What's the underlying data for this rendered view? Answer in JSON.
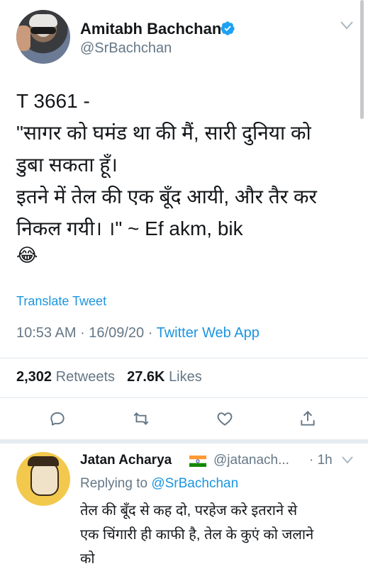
{
  "tweet": {
    "author_name": "Amitabh Bachchan",
    "author_handle": "@SrBachchan",
    "text": "T 3661 -\n\"सागर को घमंड था की मैं, सारी दुनिया को\nडुबा सकता हूँ।\nइतने में तेल की एक बूँद आयी, और तैर कर\nनिकल गयी। ।\" ~ Ef akm, bik",
    "emoji": "😂",
    "translate_label": "Translate Tweet",
    "time": "10:53 AM",
    "date": "16/09/20",
    "source": "Twitter Web App",
    "retweets_count": "2,302",
    "retweets_label": "Retweets",
    "likes_count": "27.6K",
    "likes_label": "Likes"
  },
  "icons": {
    "verified": "verified-badge-icon",
    "chevron": "chevron-down-icon",
    "reply": "reply-icon",
    "retweet": "retweet-icon",
    "like": "heart-icon",
    "share": "share-icon",
    "flag": "india-flag-icon"
  },
  "reply": {
    "author_name": "Jatan Acharya",
    "author_handle": "@jatanach...",
    "time": "· 1h",
    "replying_prefix": "Replying to",
    "replying_to": "@SrBachchan",
    "text": "तेल की बूँद से कह दो, परहेज करे इतराने से\nएक चिंगारी ही काफी है, तेल के कुएं को जलाने\nको"
  },
  "colors": {
    "accent": "#1b95e0",
    "secondary_text": "#657786",
    "divider": "#e1e8ed"
  }
}
